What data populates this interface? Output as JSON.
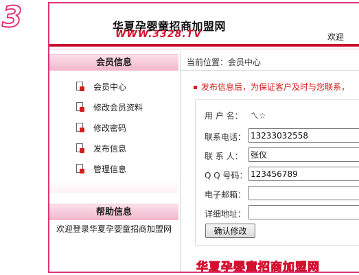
{
  "step_badge": "3",
  "header": {
    "logo_cn": "华夏孕婴童招商加盟网",
    "logo_url": "WWW.3328.TV",
    "welcome": "欢迎"
  },
  "sidebar": {
    "member_title": "会员信息",
    "items": [
      {
        "label": "会员中心"
      },
      {
        "label": "修改会员资料"
      },
      {
        "label": "修改密码"
      },
      {
        "label": "发布信息"
      },
      {
        "label": "管理信息"
      }
    ],
    "help_title": "帮助信息",
    "help_text": "欢迎登录华夏孕婴童招商加盟网"
  },
  "main": {
    "breadcrumb": "当前位置：会员中心",
    "notice": "发布信息后，为保证客户及时与您联系，",
    "form": {
      "username_label": "用 户 名：",
      "username_value": "ㄟ☆",
      "phone_label": "联系电话：",
      "phone_value": "13233032558",
      "contact_label": "联 系 人：",
      "contact_value": "张仪",
      "qq_label": "Q Q 号码：",
      "qq_value": "123456789",
      "email_label": "电子邮箱：",
      "email_value": "",
      "address_label": "详细地址：",
      "address_value": "",
      "submit_label": "确认修改"
    },
    "footer_brand": "华夏孕婴童招商加盟网"
  },
  "colors": {
    "brand_pink": "#e2357a",
    "brand_red": "#c8102e",
    "notice_red": "#d0201e"
  }
}
